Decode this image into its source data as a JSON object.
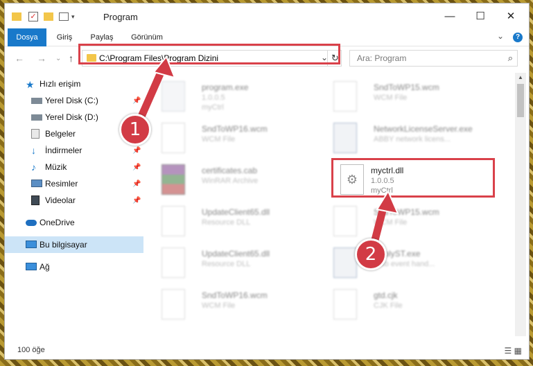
{
  "window": {
    "title": "Program",
    "quick_access_icons": [
      "folder-icon",
      "properties-check-icon",
      "new-folder-icon",
      "customize-icon"
    ],
    "controls": {
      "minimize": "—",
      "maximize": "☐",
      "close": "✕"
    }
  },
  "ribbon": {
    "tabs": [
      "Dosya",
      "Giriş",
      "Paylaş",
      "Görünüm"
    ],
    "help_icon": "?",
    "expand_icon": "⌄"
  },
  "navigation": {
    "address": "C:\\Program Files\\Program Dizini",
    "search_placeholder": "Ara: Program"
  },
  "sidebar": {
    "items": [
      {
        "label": "Hızlı erişim",
        "icon": "star-icon",
        "pinned": false
      },
      {
        "label": "Yerel Disk (C:)",
        "icon": "drive-icon",
        "pinned": true
      },
      {
        "label": "Yerel Disk (D:)",
        "icon": "drive-icon",
        "pinned": false
      },
      {
        "label": "Belgeler",
        "icon": "documents-icon",
        "pinned": true
      },
      {
        "label": "İndirmeler",
        "icon": "download-icon",
        "pinned": true
      },
      {
        "label": "Müzik",
        "icon": "music-icon",
        "pinned": true
      },
      {
        "label": "Resimler",
        "icon": "pictures-icon",
        "pinned": true
      },
      {
        "label": "Videolar",
        "icon": "videos-icon",
        "pinned": true
      },
      {
        "label": "OneDrive",
        "icon": "cloud-icon",
        "pinned": false
      },
      {
        "label": "Bu bilgisayar",
        "icon": "computer-icon",
        "pinned": false,
        "selected": true
      },
      {
        "label": "Ağ",
        "icon": "network-icon",
        "pinned": false
      }
    ]
  },
  "files": [
    {
      "name": "program.exe",
      "line2": "1.0.0.5",
      "line3": "myCtrl",
      "icon": "exe-icon",
      "blurred": true
    },
    {
      "name": "SndToWP15.wcm",
      "line2": "WCM File",
      "line3": "",
      "icon": "blank-file-icon",
      "blurred": true
    },
    {
      "name": "SndToWP16.wcm",
      "line2": "WCM File",
      "line3": "",
      "icon": "blank-file-icon",
      "blurred": true
    },
    {
      "name": "NetworkLicenseServer.exe",
      "line2": "ABBY network licens...",
      "line3": "",
      "icon": "window-app-icon",
      "blurred": true
    },
    {
      "name": "certificates.cab",
      "line2": "WinRAR Archive",
      "line3": "",
      "icon": "winrar-icon",
      "blurred": true
    },
    {
      "name": "myctrl.dll",
      "line2": "1.0.0.5",
      "line3": "myCtrl",
      "icon": "dll-gear-icon",
      "blurred": false
    },
    {
      "name": "UpdateClient65.dll",
      "line2": "Resource DLL",
      "line3": "",
      "icon": "blank-file-icon",
      "blurred": true
    },
    {
      "name": "SndToWP15.wcm",
      "line2": "WCM File",
      "line3": "",
      "icon": "blank-file-icon",
      "blurred": true
    },
    {
      "name": "UpdateClient65.dll",
      "line2": "Resource DLL",
      "line3": "",
      "icon": "blank-file-icon",
      "blurred": true
    },
    {
      "name": "ReplyST.exe",
      "line2": "Y sb event hand...",
      "line3": "",
      "icon": "window-app-icon",
      "blurred": true
    },
    {
      "name": "SndToWP16.wcm",
      "line2": "WCM File",
      "line3": "",
      "icon": "blank-file-icon",
      "blurred": true
    },
    {
      "name": "gtd.cjk",
      "line2": "CJK File",
      "line3": "",
      "icon": "blank-file-icon",
      "blurred": true
    }
  ],
  "status": {
    "count": "100 öğe"
  },
  "callouts": {
    "step1": "1",
    "step2": "2"
  },
  "colors": {
    "accent": "#1979ca",
    "highlight": "#d9414a",
    "selection": "#cce4f7"
  }
}
